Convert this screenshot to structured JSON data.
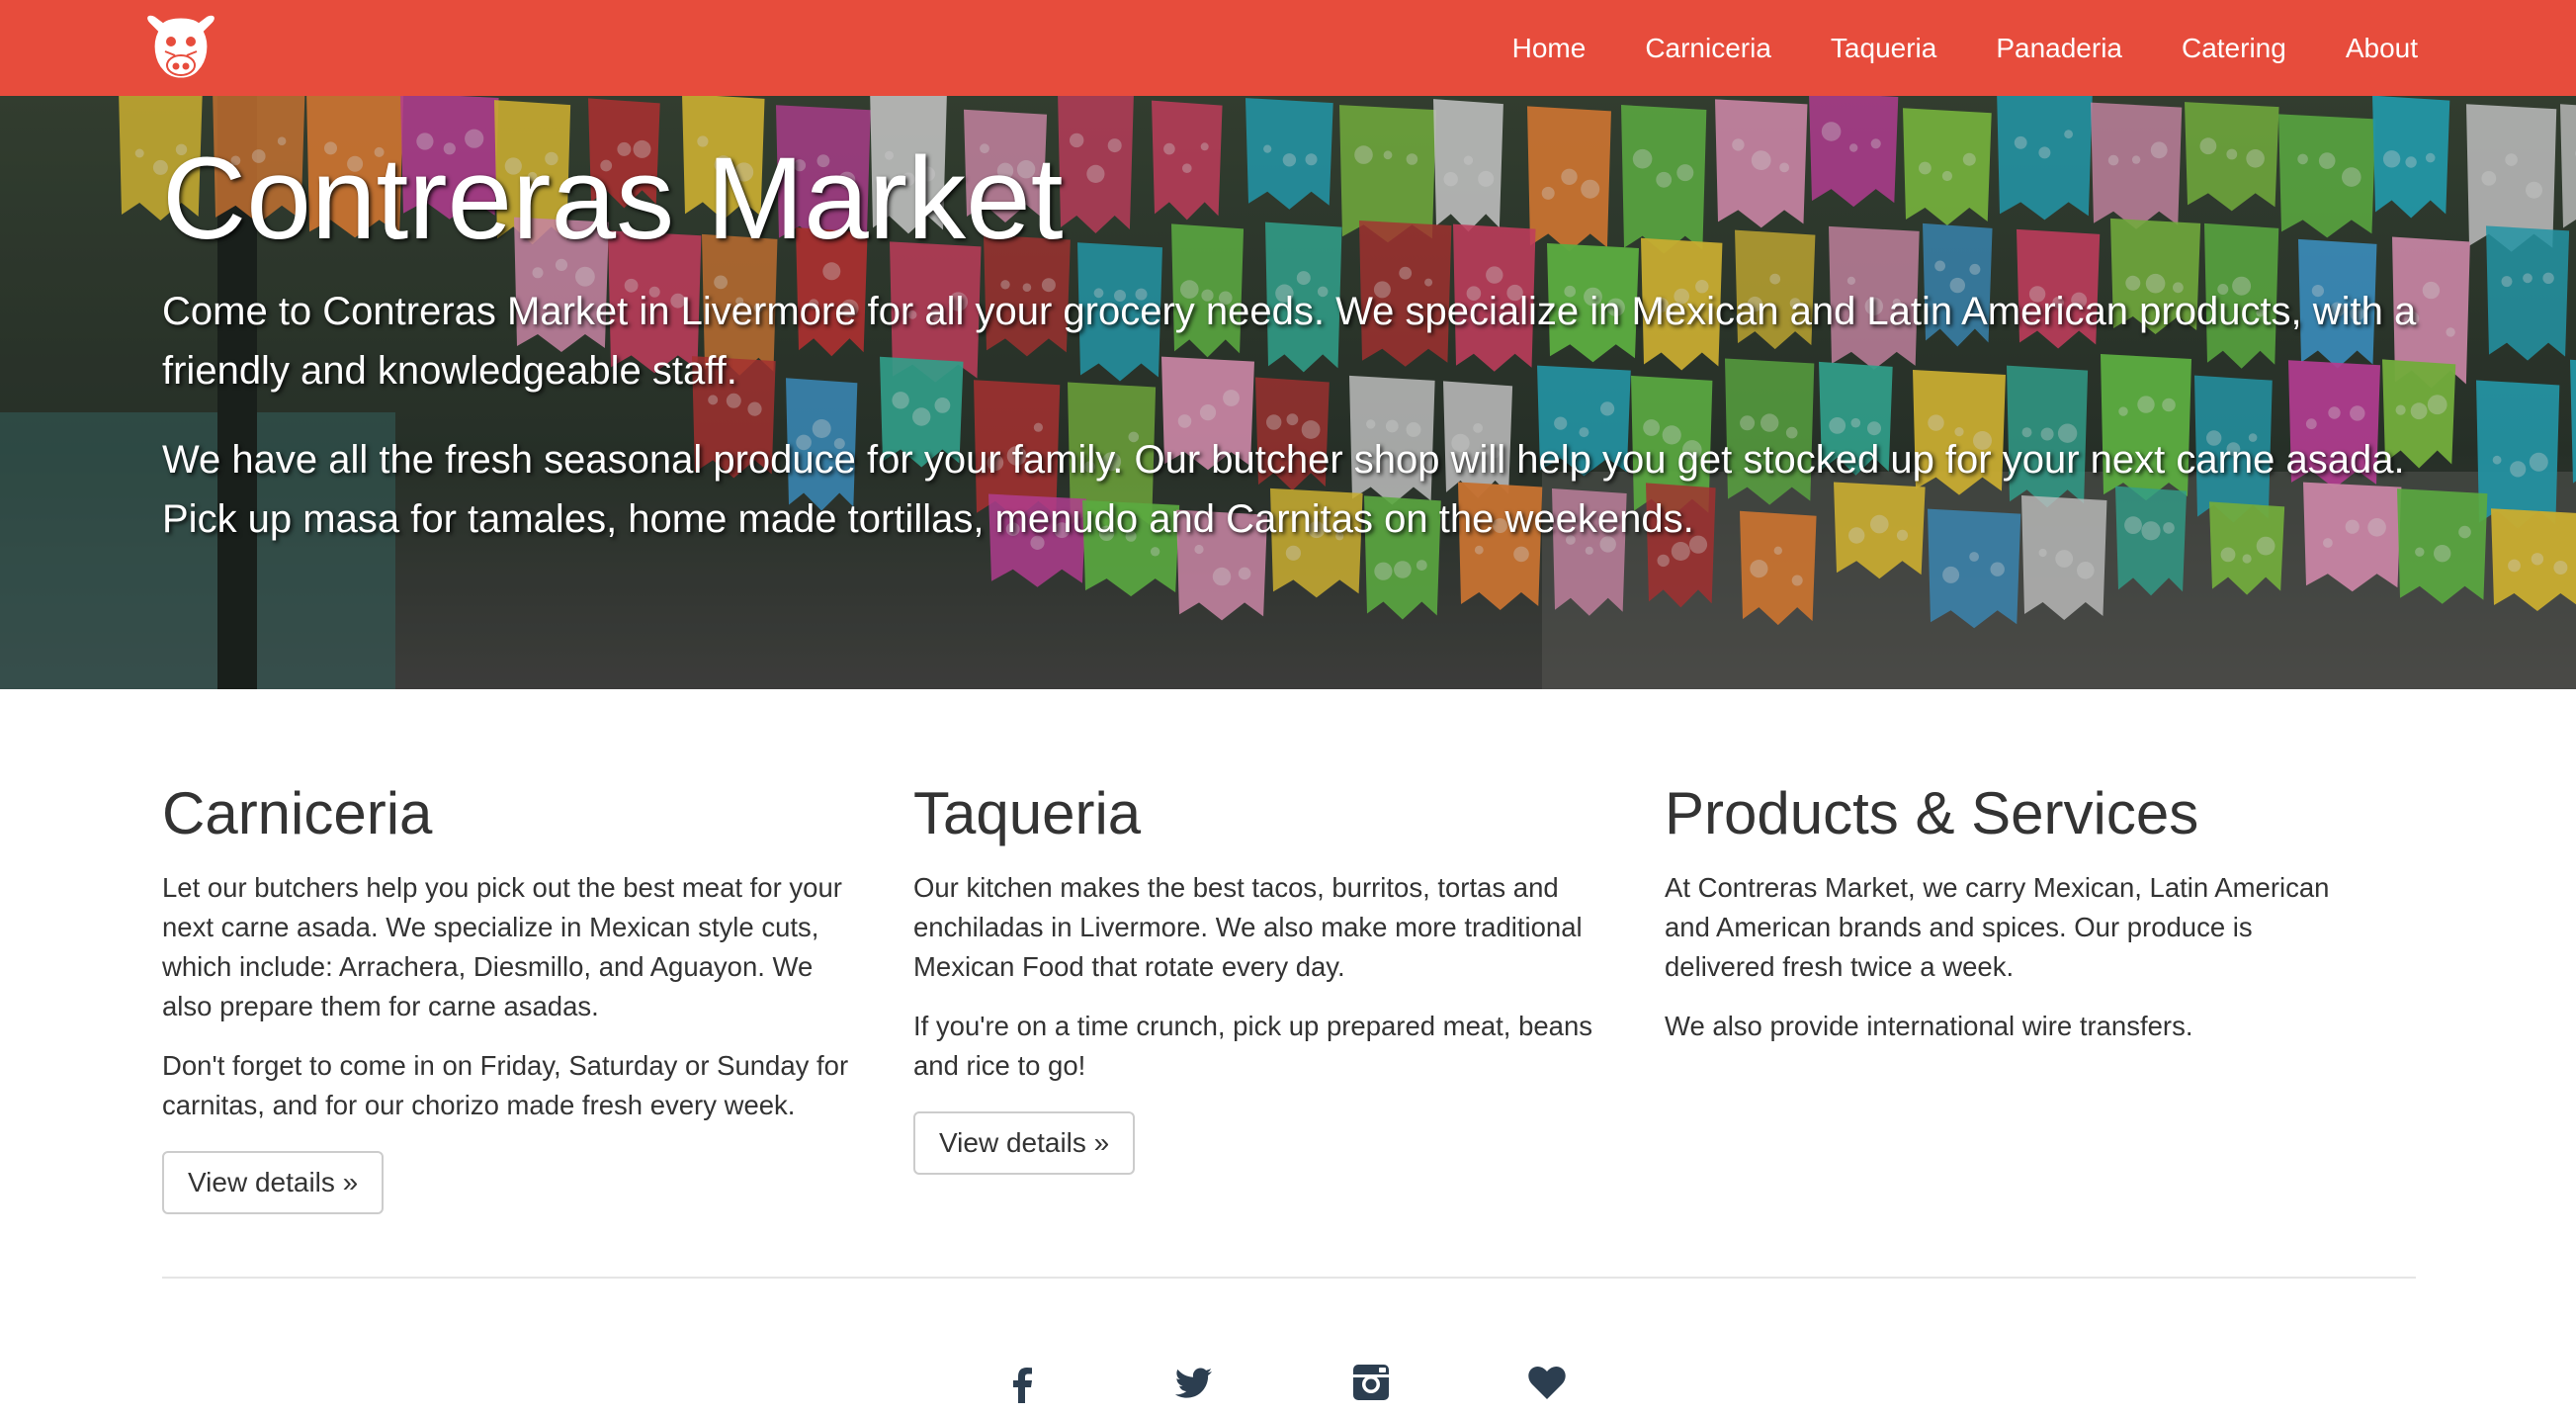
{
  "brand": {
    "logo_icon": "bull-head-logo-icon"
  },
  "nav": {
    "items": [
      {
        "label": "Home"
      },
      {
        "label": "Carniceria"
      },
      {
        "label": "Taqueria"
      },
      {
        "label": "Panaderia"
      },
      {
        "label": "Catering"
      },
      {
        "label": "About"
      }
    ]
  },
  "hero": {
    "title": "Contreras Market",
    "paragraphs": [
      "Come to Contreras Market in Livermore for all your grocery needs. We specialize in Mexican and Latin American products, with a friendly and knowledgeable staff.",
      "We have all the fresh seasonal produce for your family. Our butcher shop will help you get stocked up for your next carne asada. Pick up masa for tamales, home made tortillas, menudo and Carnitas on the weekends."
    ]
  },
  "sections": [
    {
      "title": "Carniceria",
      "paragraphs": [
        "Let our butchers help you pick out the best meat for your next carne asada. We specialize in Mexican style cuts, which include: Arrachera, Diesmillo, and Aguayon. We also prepare them for carne asadas.",
        "Don't forget to come in on Friday, Saturday or Sunday for carnitas, and for our chorizo made fresh every week."
      ],
      "button": "View details »"
    },
    {
      "title": "Taqueria",
      "paragraphs": [
        "Our kitchen makes the best tacos, burritos, tortas and enchiladas in Livermore. We also make more traditional Mexican Food that rotate every day.",
        "If you're on a time crunch, pick up prepared meat, beans and rice to go!"
      ],
      "button": "View details »"
    },
    {
      "title": "Products & Services",
      "paragraphs": [
        "At Contreras Market, we carry Mexican, Latin American and American brands and spices. Our produce is delivered fresh twice a week.",
        "We also provide international wire transfers."
      ]
    }
  ],
  "social": {
    "icons": [
      "facebook-icon",
      "twitter-icon",
      "instagram-icon",
      "heart-icon"
    ]
  },
  "colors": {
    "navbar": "#e74c3c",
    "text": "#333333",
    "social_icon": "#2c3e50"
  }
}
